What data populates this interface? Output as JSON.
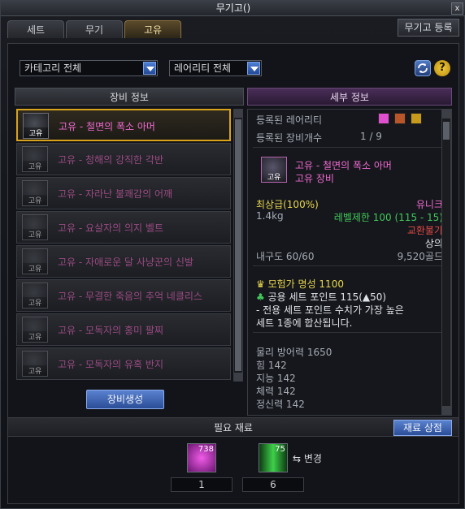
{
  "window": {
    "title": "무기고()",
    "close": "x"
  },
  "tabs": [
    {
      "label": "세트"
    },
    {
      "label": "무기"
    },
    {
      "label": "고유"
    }
  ],
  "register_button": "무기고 등록",
  "filters": {
    "category": "카테고리 전체",
    "rarity": "레어리티 전체"
  },
  "help_label": "?",
  "equipment_panel": {
    "title": "장비 정보",
    "generate_button": "장비생성"
  },
  "items": [
    {
      "tag": "고유",
      "name": "고유 - 철면의 폭소 아머",
      "selected": true
    },
    {
      "tag": "고유",
      "name": "고유 - 청해의 강직한 각반"
    },
    {
      "tag": "고유",
      "name": "고유 - 자라난 불쾌감의 어깨"
    },
    {
      "tag": "고유",
      "name": "고유 - 요살자의 의지 벨트"
    },
    {
      "tag": "고유",
      "name": "고유 - 자애로운 달 사냥꾼의 신발"
    },
    {
      "tag": "고유",
      "name": "고유 - 무결한 죽음의 추억 네클리스"
    },
    {
      "tag": "고유",
      "name": "고유 - 모독자의 홍미 팔찌"
    },
    {
      "tag": "고유",
      "name": "고유 - 모독자의 유혹 반지"
    }
  ],
  "detail": {
    "title": "세부 정보",
    "registered_rarity_label": "등록된 레어리티",
    "registered_count_label": "등록된 장비개수",
    "registered_count": "1 / 9",
    "rarity_colors": [
      "#e04fd0",
      "#b8562a",
      "#c79a1c"
    ],
    "item_tag": "고유",
    "item_name": "고유 - 철면의 폭소 아머",
    "item_type": "고유 장비",
    "grade": "최상급(100%)",
    "rarity": "유니크",
    "weight": "1.4kg",
    "level_limit": "레벨제한 100 (115 - 15)",
    "trade": "교환불가",
    "slot": "상의",
    "durability": "내구도 60/60",
    "price": "9,520골드",
    "fame": "모험가 명성 1100",
    "set_point": "공용 세트 포인트 115(▲50)",
    "set_note_1": "- 전용 세트 포인트 수치가 가장 높은",
    "set_note_2": "세트 1종에 합산됩니다.",
    "stats": [
      "물리 방어력 1650",
      "힘 142",
      "지능 142",
      "체력 142",
      "정신력 142"
    ]
  },
  "materials": {
    "title": "필요 재료",
    "shop_button": "재료 상점",
    "change_label": "변경",
    "items": [
      {
        "owned": "738",
        "required": "1"
      },
      {
        "owned": "75",
        "required": "6"
      }
    ]
  }
}
